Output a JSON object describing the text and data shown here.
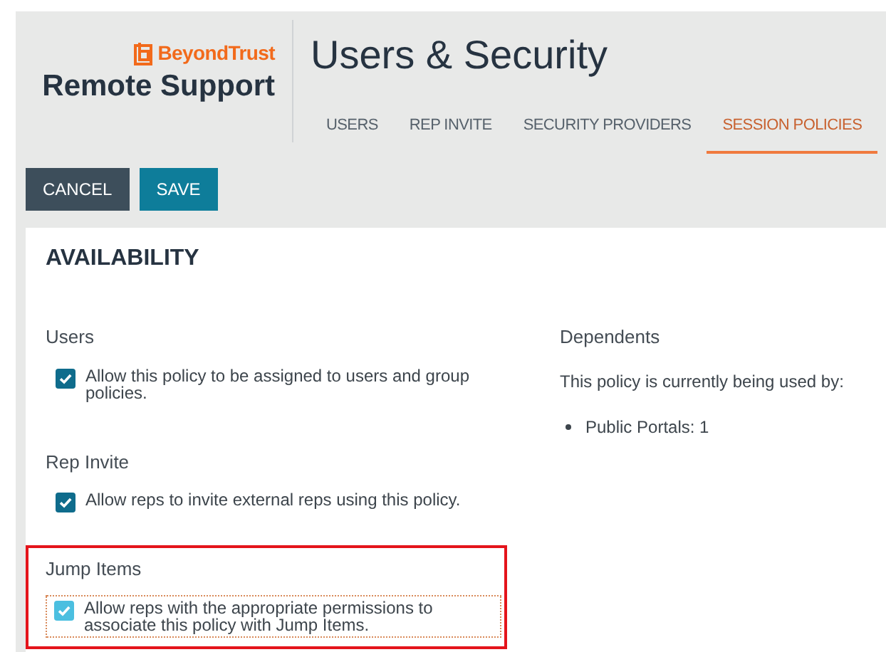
{
  "brand": {
    "company": "BeyondTrust",
    "product": "Remote Support"
  },
  "page_title": "Users & Security",
  "tabs": [
    {
      "label": "USERS",
      "selected": false
    },
    {
      "label": "REP INVITE",
      "selected": false
    },
    {
      "label": "SECURITY PROVIDERS",
      "selected": false
    },
    {
      "label": "SESSION POLICIES",
      "selected": true
    }
  ],
  "buttons": [
    {
      "label": "CANCEL",
      "kind": "secondary"
    },
    {
      "label": "SAVE",
      "kind": "primary"
    }
  ],
  "section_title": "AVAILABILITY",
  "settings": [
    {
      "heading": "Users",
      "label": "Allow this policy to be assigned to users and group policies.",
      "checked": true,
      "focused": false,
      "highlighted": false
    },
    {
      "heading": "Rep Invite",
      "label": "Allow reps to invite external reps using this policy.",
      "checked": true,
      "focused": false,
      "highlighted": false
    },
    {
      "heading": "Jump Items",
      "label": "Allow reps with the appropriate permissions to associate this policy with Jump Items.",
      "checked": true,
      "focused": true,
      "highlighted": true
    }
  ],
  "dependents": {
    "heading": "Dependents",
    "text": "This policy is currently being used by:",
    "items": [
      "Public Portals: 1"
    ]
  }
}
